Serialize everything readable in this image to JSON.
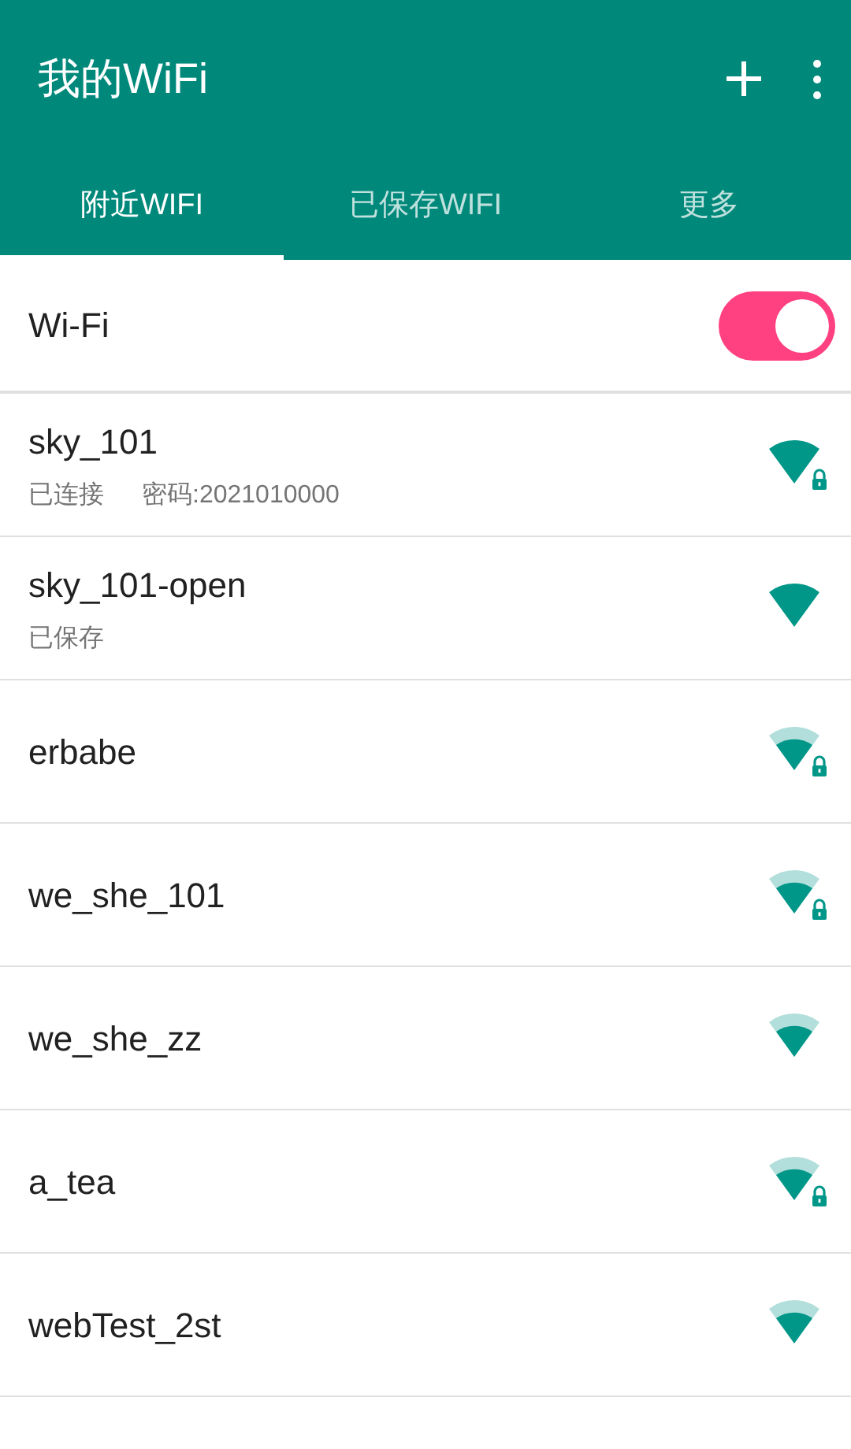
{
  "app_bar": {
    "title": "我的WiFi"
  },
  "tabs": [
    {
      "label": "附近WIFI",
      "selected": true
    },
    {
      "label": "已保存WIFI",
      "selected": false
    },
    {
      "label": "更多",
      "selected": false
    }
  ],
  "wifi_switch": {
    "label": "Wi-Fi",
    "on": true
  },
  "networks": [
    {
      "name": "sky_101",
      "status": "已连接",
      "password": "密码:2021010000",
      "kind": "full",
      "locked": true
    },
    {
      "name": "sky_101-open",
      "status": "已保存",
      "kind": "full",
      "locked": false
    },
    {
      "name": "erbabe",
      "kind": "fair",
      "locked": true
    },
    {
      "name": "we_she_101",
      "kind": "fair",
      "locked": true
    },
    {
      "name": "we_she_zz",
      "kind": "fair",
      "locked": false
    },
    {
      "name": "a_tea",
      "kind": "fair",
      "locked": true
    },
    {
      "name": "webTest_2st",
      "kind": "fair",
      "locked": false
    }
  ]
}
